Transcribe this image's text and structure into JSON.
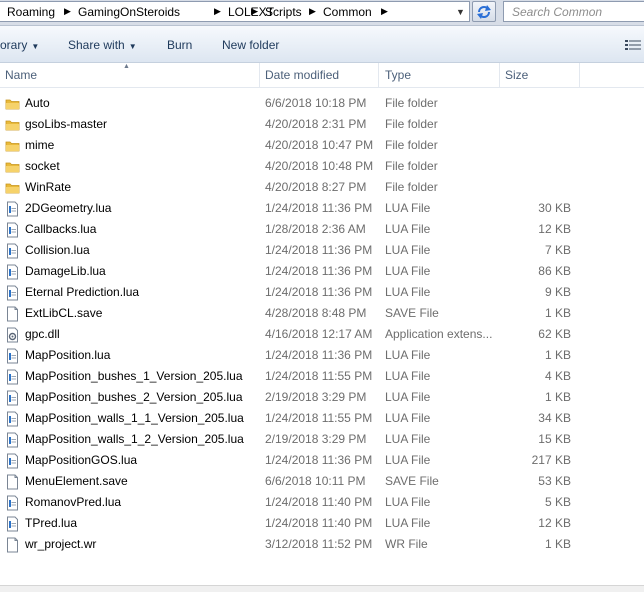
{
  "address": {
    "crumbs": [
      "Roaming",
      "GamingOnSteroids",
      "LOLEXT",
      "Scripts",
      "Common"
    ],
    "search_placeholder": "Search Common"
  },
  "toolbar": {
    "library_label": "orary",
    "share_label": "Share with",
    "burn_label": "Burn",
    "new_folder_label": "New folder"
  },
  "columns": {
    "name": "Name",
    "date": "Date modified",
    "type": "Type",
    "size": "Size"
  },
  "files": [
    {
      "name": "Auto",
      "date": "6/6/2018 10:18 PM",
      "type": "File folder",
      "size": "",
      "icon": "folder"
    },
    {
      "name": "gsoLibs-master",
      "date": "4/20/2018 2:31 PM",
      "type": "File folder",
      "size": "",
      "icon": "folder"
    },
    {
      "name": "mime",
      "date": "4/20/2018 10:47 PM",
      "type": "File folder",
      "size": "",
      "icon": "folder"
    },
    {
      "name": "socket",
      "date": "4/20/2018 10:48 PM",
      "type": "File folder",
      "size": "",
      "icon": "folder"
    },
    {
      "name": "WinRate",
      "date": "4/20/2018 8:27 PM",
      "type": "File folder",
      "size": "",
      "icon": "folder"
    },
    {
      "name": "2DGeometry.lua",
      "date": "1/24/2018 11:36 PM",
      "type": "LUA File",
      "size": "30 KB",
      "icon": "file"
    },
    {
      "name": "Callbacks.lua",
      "date": "1/28/2018 2:36 AM",
      "type": "LUA File",
      "size": "12 KB",
      "icon": "file"
    },
    {
      "name": "Collision.lua",
      "date": "1/24/2018 11:36 PM",
      "type": "LUA File",
      "size": "7 KB",
      "icon": "file"
    },
    {
      "name": "DamageLib.lua",
      "date": "1/24/2018 11:36 PM",
      "type": "LUA File",
      "size": "86 KB",
      "icon": "file"
    },
    {
      "name": "Eternal Prediction.lua",
      "date": "1/24/2018 11:36 PM",
      "type": "LUA File",
      "size": "9 KB",
      "icon": "file"
    },
    {
      "name": "ExtLibCL.save",
      "date": "4/28/2018 8:48 PM",
      "type": "SAVE File",
      "size": "1 KB",
      "icon": "blank"
    },
    {
      "name": "gpc.dll",
      "date": "4/16/2018 12:17 AM",
      "type": "Application extens...",
      "size": "62 KB",
      "icon": "dll"
    },
    {
      "name": "MapPosition.lua",
      "date": "1/24/2018 11:36 PM",
      "type": "LUA File",
      "size": "1 KB",
      "icon": "file"
    },
    {
      "name": "MapPosition_bushes_1_Version_205.lua",
      "date": "1/24/2018 11:55 PM",
      "type": "LUA File",
      "size": "4 KB",
      "icon": "file"
    },
    {
      "name": "MapPosition_bushes_2_Version_205.lua",
      "date": "2/19/2018 3:29 PM",
      "type": "LUA File",
      "size": "1 KB",
      "icon": "file"
    },
    {
      "name": "MapPosition_walls_1_1_Version_205.lua",
      "date": "1/24/2018 11:55 PM",
      "type": "LUA File",
      "size": "34 KB",
      "icon": "file"
    },
    {
      "name": "MapPosition_walls_1_2_Version_205.lua",
      "date": "2/19/2018 3:29 PM",
      "type": "LUA File",
      "size": "15 KB",
      "icon": "file"
    },
    {
      "name": "MapPositionGOS.lua",
      "date": "1/24/2018 11:36 PM",
      "type": "LUA File",
      "size": "217 KB",
      "icon": "file"
    },
    {
      "name": "MenuElement.save",
      "date": "6/6/2018 10:11 PM",
      "type": "SAVE File",
      "size": "53 KB",
      "icon": "blank"
    },
    {
      "name": "RomanovPred.lua",
      "date": "1/24/2018 11:40 PM",
      "type": "LUA File",
      "size": "5 KB",
      "icon": "file"
    },
    {
      "name": "TPred.lua",
      "date": "1/24/2018 11:40 PM",
      "type": "LUA File",
      "size": "12 KB",
      "icon": "file"
    },
    {
      "name": "wr_project.wr",
      "date": "3/12/2018 11:52 PM",
      "type": "WR File",
      "size": "1 KB",
      "icon": "blank"
    }
  ]
}
